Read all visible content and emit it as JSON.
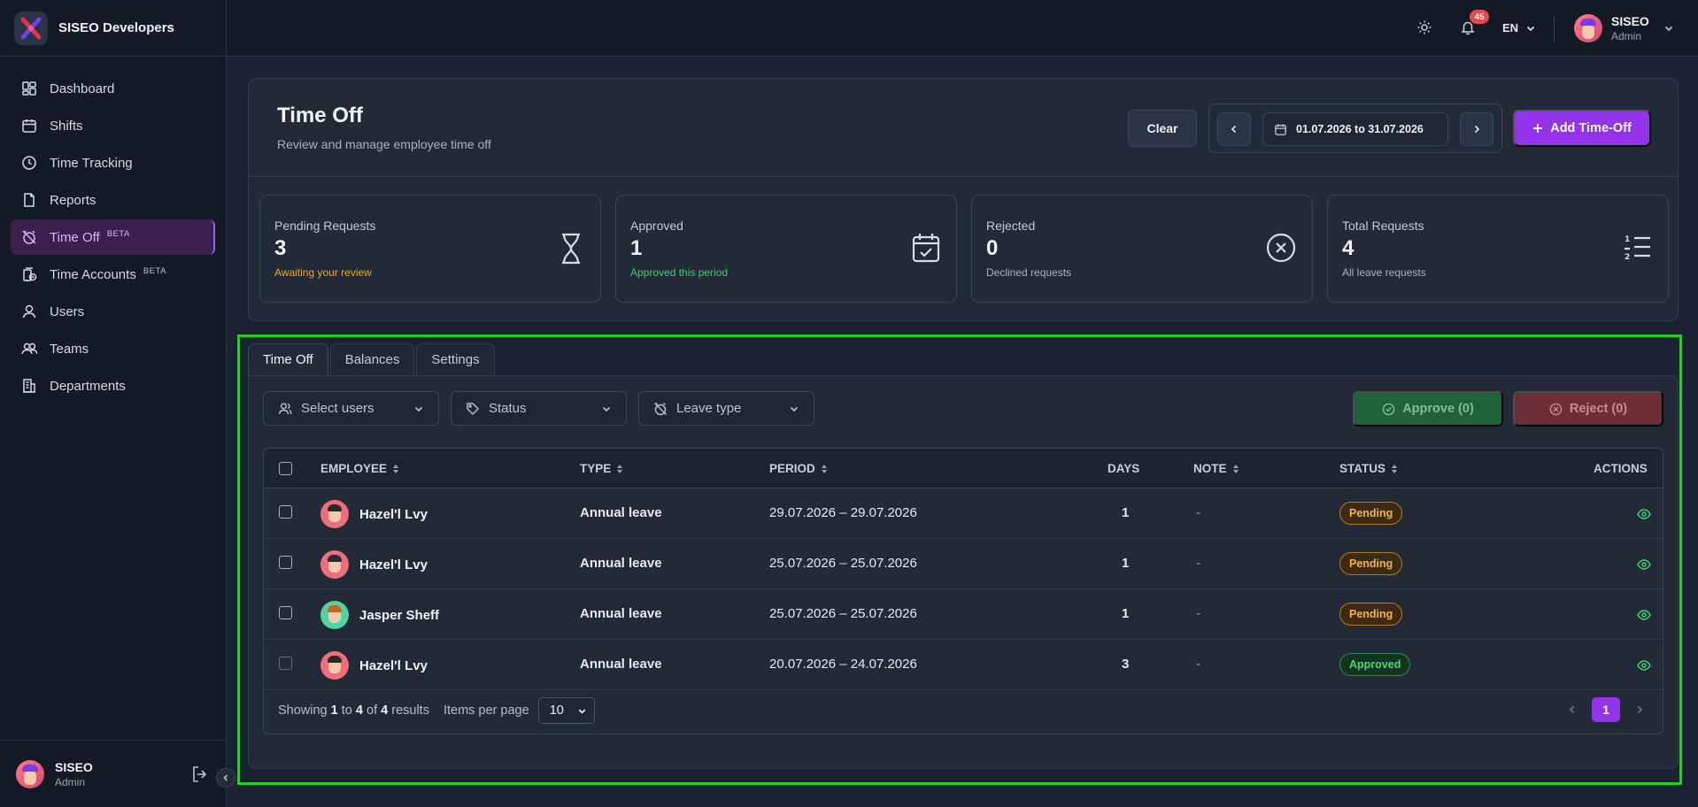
{
  "app": {
    "brand": "SISEO Developers"
  },
  "sidebar": {
    "items": [
      {
        "label": "Dashboard",
        "icon": "dashboard-icon"
      },
      {
        "label": "Shifts",
        "icon": "calendar-icon"
      },
      {
        "label": "Time Tracking",
        "icon": "clock-icon"
      },
      {
        "label": "Reports",
        "icon": "document-icon"
      },
      {
        "label": "Time Off",
        "badge": "BETA",
        "icon": "alarm-off-icon",
        "active": true
      },
      {
        "label": "Time Accounts",
        "badge": "BETA",
        "icon": "clock-history-icon"
      },
      {
        "label": "Users",
        "icon": "user-icon"
      },
      {
        "label": "Teams",
        "icon": "users-icon"
      },
      {
        "label": "Departments",
        "icon": "building-icon"
      }
    ],
    "footer": {
      "name": "SISEO",
      "role": "Admin"
    }
  },
  "topbar": {
    "notifications": "45",
    "language": "EN",
    "user": {
      "name": "SISEO",
      "role": "Admin"
    }
  },
  "page": {
    "title": "Time Off",
    "subtitle": "Review and manage employee time off",
    "clear_label": "Clear",
    "date_range": "01.07.2026 to 31.07.2026",
    "add_label": "Add Time-Off"
  },
  "stats": [
    {
      "label": "Pending Requests",
      "value": "3",
      "hint": "Awaiting your review",
      "hint_color": "#f5a524",
      "icon": "hourglass-icon"
    },
    {
      "label": "Approved",
      "value": "1",
      "hint": "Approved this period",
      "hint_color": "#3ecf6f",
      "icon": "calendar-check-icon"
    },
    {
      "label": "Rejected",
      "value": "0",
      "hint": "Declined requests",
      "hint_color": "#a8b0bd",
      "icon": "x-circle-icon"
    },
    {
      "label": "Total Requests",
      "value": "4",
      "hint": "All leave requests",
      "hint_color": "#a8b0bd",
      "icon": "numbered-list-icon"
    }
  ],
  "tabs": [
    "Time Off",
    "Balances",
    "Settings"
  ],
  "filters": {
    "users": "Select users",
    "status": "Status",
    "leave_type": "Leave type",
    "approve": "Approve (0)",
    "reject": "Reject (0)"
  },
  "table": {
    "columns": {
      "employee": "EMPLOYEE",
      "type": "TYPE",
      "period": "PERIOD",
      "days": "DAYS",
      "note": "NOTE",
      "status": "STATUS",
      "actions": "ACTIONS"
    },
    "rows": [
      {
        "employee": "Hazel'l Lvy",
        "type": "Annual leave",
        "period": "29.07.2026 – 29.07.2026",
        "days": "1",
        "note": "-",
        "status": "Pending",
        "avatar_color": "#f06e7c"
      },
      {
        "employee": "Hazel'l Lvy",
        "type": "Annual leave",
        "period": "25.07.2026 – 25.07.2026",
        "days": "1",
        "note": "-",
        "status": "Pending",
        "avatar_color": "#f06e7c"
      },
      {
        "employee": "Jasper Sheff",
        "type": "Annual leave",
        "period": "25.07.2026 – 25.07.2026",
        "days": "1",
        "note": "-",
        "status": "Pending",
        "avatar_color": "#4ed4a0"
      },
      {
        "employee": "Hazel'l Lvy",
        "type": "Annual leave",
        "period": "20.07.2026 – 24.07.2026",
        "days": "3",
        "note": "-",
        "status": "Approved",
        "avatar_color": "#f06e7c"
      }
    ],
    "footer": {
      "showing": "Showing",
      "from": "1",
      "to_word": "to",
      "to": "4",
      "of_word": "of",
      "total": "4",
      "results": "results",
      "items_per_page": "Items per page",
      "per_page_value": "10",
      "current_page": "1"
    }
  }
}
